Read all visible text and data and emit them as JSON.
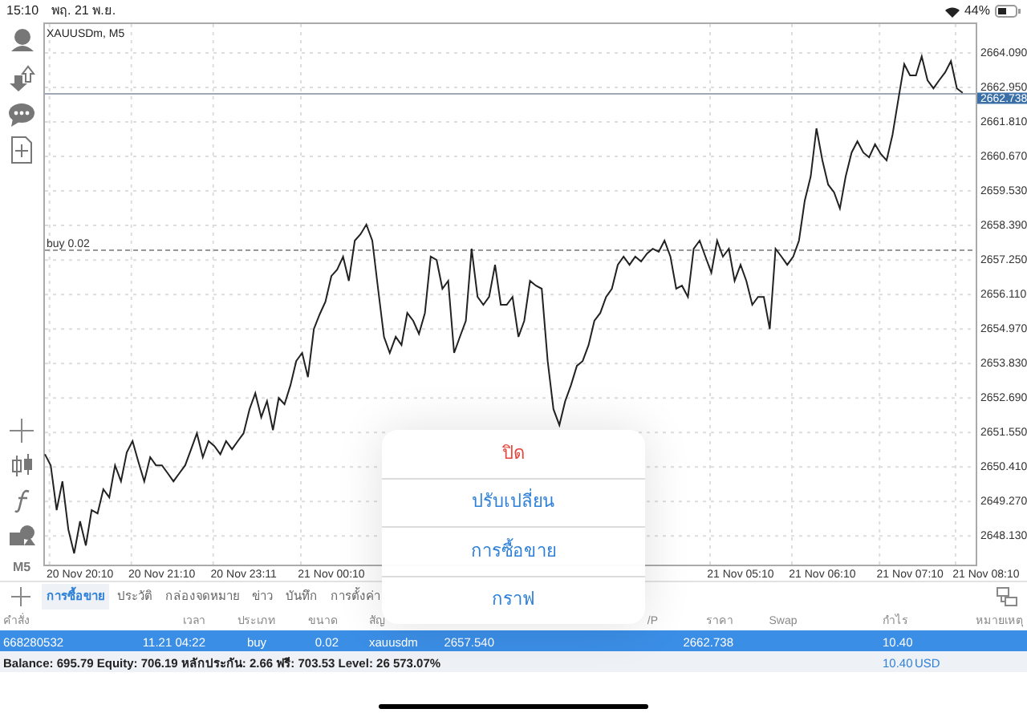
{
  "status_bar": {
    "time": "15:10",
    "date": "พฤ. 21 พ.ย.",
    "battery": "44%"
  },
  "toolbar": {
    "timeframe": "M5"
  },
  "chart": {
    "chart_data": {
      "type": "line",
      "title": "XAUUSDm, M5",
      "grid": true,
      "ylim": [
        2647.18,
        2665.1
      ],
      "categories": [
        null,
        null,
        null,
        null,
        null,
        null,
        "20 Nov 20:10",
        null,
        null,
        null,
        null,
        null,
        null,
        null,
        null,
        null,
        null,
        null,
        null,
        null,
        "20 Nov 21:10",
        null,
        null,
        null,
        null,
        null,
        null,
        null,
        null,
        null,
        null,
        null,
        null,
        null,
        "20 Nov 23:11",
        null,
        null,
        null,
        null,
        null,
        null,
        null,
        null,
        null,
        null,
        null,
        null,
        null,
        null,
        "21 Nov 00:10",
        null,
        null,
        null,
        null,
        null,
        null,
        null,
        null,
        null,
        null,
        null,
        null,
        null,
        null,
        null,
        null,
        null,
        null,
        null,
        null,
        null,
        null,
        null,
        null,
        null,
        null,
        null,
        null,
        null,
        null,
        null,
        null,
        null,
        null,
        null,
        null,
        null,
        null,
        null,
        null,
        null,
        null,
        null,
        null,
        null,
        null,
        null,
        null,
        null,
        null,
        null,
        null,
        null,
        null,
        null,
        null,
        null,
        null,
        null,
        null,
        null,
        null,
        null,
        null,
        null,
        null,
        null,
        null,
        null,
        "21 Nov 05:10",
        null,
        null,
        null,
        null,
        null,
        null,
        null,
        null,
        null,
        null,
        null,
        null,
        null,
        "21 Nov 06:10",
        null,
        null,
        null,
        null,
        null,
        null,
        null,
        null,
        null,
        null,
        null,
        null,
        null,
        null,
        "21 Nov 07:10",
        null,
        null,
        null,
        null,
        null,
        null,
        null,
        null,
        null,
        null,
        null,
        null,
        "21 Nov 08:10"
      ],
      "series": [
        {
          "color": "#222222",
          "values": [
            2650.83,
            2650.46,
            2648.98,
            2649.93,
            2648.34,
            2647.55,
            2648.61,
            2647.81,
            2648.98,
            2648.87,
            2649.67,
            2649.4,
            2650.46,
            2649.93,
            2650.89,
            2651.26,
            2650.57,
            2649.93,
            2650.73,
            2650.46,
            2650.46,
            2650.2,
            2649.93,
            2650.2,
            2650.46,
            2650.99,
            2651.52,
            2650.73,
            2651.26,
            2651.1,
            2650.83,
            2651.26,
            2650.99,
            2651.26,
            2651.52,
            2652.32,
            2652.85,
            2652.05,
            2652.58,
            2651.63,
            2652.69,
            2652.48,
            2653.11,
            2653.91,
            2654.18,
            2653.38,
            2654.97,
            2655.45,
            2655.87,
            2656.72,
            2656.93,
            2657.36,
            2656.56,
            2657.89,
            2658.1,
            2658.42,
            2657.89,
            2656.3,
            2654.71,
            2654.18,
            2654.71,
            2654.44,
            2655.5,
            2655.24,
            2654.81,
            2655.5,
            2657.36,
            2657.25,
            2656.3,
            2656.56,
            2654.18,
            2654.71,
            2655.24,
            2657.62,
            2656.03,
            2655.77,
            2656.03,
            2657.09,
            2655.77,
            2655.77,
            2656.03,
            2654.71,
            2655.24,
            2656.56,
            2656.4,
            2656.3,
            2653.91,
            2652.32,
            2651.79,
            2652.58,
            2653.11,
            2653.75,
            2653.91,
            2654.44,
            2655.24,
            2655.5,
            2656.03,
            2656.3,
            2657.09,
            2657.36,
            2657.09,
            2657.36,
            2657.2,
            2657.46,
            2657.62,
            2657.52,
            2657.89,
            2657.36,
            2656.3,
            2656.4,
            2656.03,
            2657.62,
            2657.89,
            2657.36,
            2656.83,
            2657.89,
            2657.36,
            2657.62,
            2656.56,
            2657.09,
            2656.56,
            2655.77,
            2656.03,
            2656.03,
            2654.97,
            2657.62,
            2657.36,
            2657.09,
            2657.36,
            2657.89,
            2659.21,
            2660.01,
            2661.6,
            2660.54,
            2659.74,
            2659.48,
            2658.95,
            2660.01,
            2660.8,
            2661.17,
            2660.8,
            2660.64,
            2661.07,
            2660.75,
            2660.54,
            2661.39,
            2662.55,
            2663.72,
            2663.35,
            2663.35,
            2663.98,
            2663.19,
            2662.92,
            2663.19,
            2663.45,
            2663.82,
            2662.92,
            2662.77,
            null,
            null,
            null,
            null
          ]
        }
      ],
      "yticks": [
        {
          "value": 2648.13,
          "label": "2648.130"
        },
        {
          "value": 2649.27,
          "label": "2649.270"
        },
        {
          "value": 2650.41,
          "label": "2650.410"
        },
        {
          "value": 2651.55,
          "label": "2651.550"
        },
        {
          "value": 2652.69,
          "label": "2652.690"
        },
        {
          "value": 2653.83,
          "label": "2653.830"
        },
        {
          "value": 2654.97,
          "label": "2654.970"
        },
        {
          "value": 2656.11,
          "label": "2656.110"
        },
        {
          "value": 2657.25,
          "label": "2657.250"
        },
        {
          "value": 2658.39,
          "label": "2658.390"
        },
        {
          "value": 2659.53,
          "label": "2659.530"
        },
        {
          "value": 2660.67,
          "label": "2660.670"
        },
        {
          "value": 2661.81,
          "label": "2661.810"
        },
        {
          "value": 2662.95,
          "label": "2662.950"
        },
        {
          "value": 2664.09,
          "label": "2664.090"
        }
      ],
      "ref_lines": [
        {
          "axis": "y",
          "value": 2657.57,
          "label": "buy 0.02"
        },
        {
          "axis": "y",
          "value": 2662.738,
          "label": "2662.738"
        }
      ]
    }
  },
  "popup_menu": {
    "items": [
      {
        "label": "ปิด",
        "kind": "destructive"
      },
      {
        "label": "ปรับเปลี่ยน",
        "kind": "action"
      },
      {
        "label": "การซื้อขาย",
        "kind": "action"
      },
      {
        "label": "กราฟ",
        "kind": "action"
      }
    ]
  },
  "tabs": [
    {
      "label": "การซื้อขาย",
      "selected": true
    },
    {
      "label": "ประวัติ",
      "selected": false
    },
    {
      "label": "กล่องจดหมาย",
      "selected": false
    },
    {
      "label": "ข่าว",
      "selected": false
    },
    {
      "label": "บันทึก",
      "selected": false
    },
    {
      "label": "การตั้งค่า",
      "selected": false
    }
  ],
  "table": {
    "columns": {
      "order": "คำสั่ง",
      "time": "เวลา",
      "type": "ประเภท",
      "volume": "ขนาด",
      "symbol": "สัญ",
      "tp": "/P",
      "price": "ราคา",
      "swap": "Swap",
      "profit": "กำไร",
      "comment": "หมายเหตุ"
    },
    "rows": [
      {
        "selected": true,
        "order": "668280532",
        "time": "11.21 04:22",
        "type": "buy",
        "volume": "0.02",
        "symbol": "xauusdm",
        "open_price": "2657.540",
        "price": "2662.738",
        "profit": "10.40"
      }
    ]
  },
  "summary": {
    "text": "Balance: 695.79 Equity: 706.19 หลักประกัน: 2.66 ฟรี: 703.53 Level: 26 573.07%",
    "profit": "10.40",
    "currency": "USD"
  }
}
